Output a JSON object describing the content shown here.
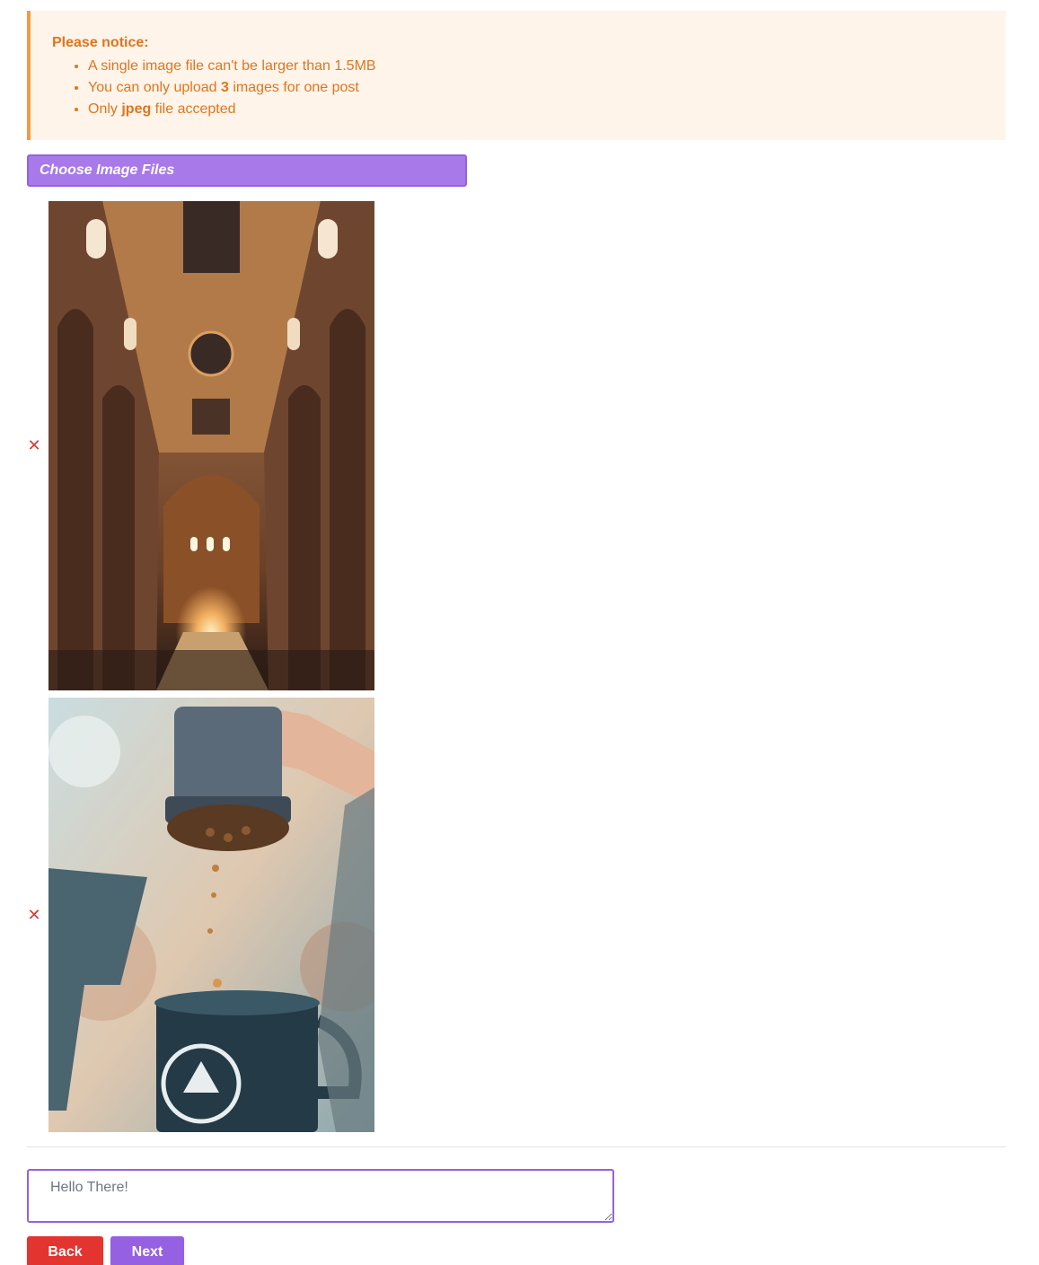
{
  "notice": {
    "title": "Please notice:",
    "items": [
      {
        "before": "A single image file can't be larger than 1.5MB",
        "strong": "",
        "after": ""
      },
      {
        "before": "You can only upload ",
        "strong": "3",
        "after": " images for one post"
      },
      {
        "before": "Only ",
        "strong": "jpeg",
        "after": " file accepted"
      }
    ]
  },
  "upload": {
    "choose_label": "Choose Image Files"
  },
  "images": [
    {
      "remove_glyph": "✕",
      "subject": "cathedral interior"
    },
    {
      "remove_glyph": "✕",
      "subject": "coffee press pouring"
    }
  ],
  "caption": {
    "value": "Hello There!"
  },
  "actions": {
    "back_label": "Back",
    "next_label": "Next"
  },
  "colors": {
    "notice_bg": "#fff4ea",
    "notice_border": "#f6993f",
    "notice_text": "#de751f",
    "accent_purple": "#9561e2",
    "danger_red": "#e3342f"
  }
}
